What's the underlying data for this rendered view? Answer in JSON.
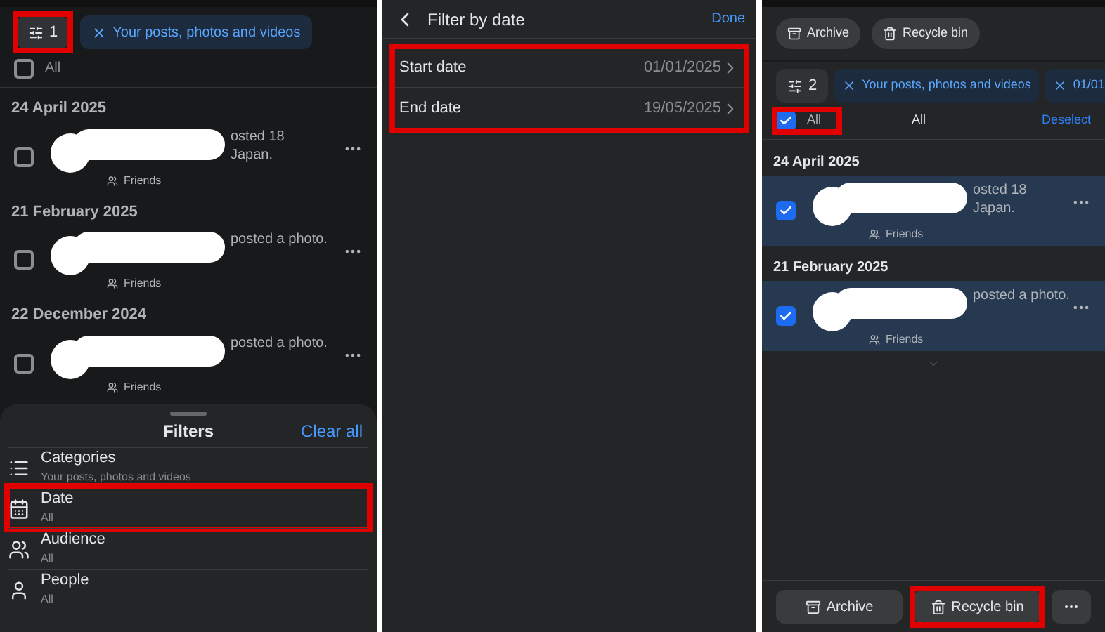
{
  "posts_list": {
    "filter_button": {
      "count": "1",
      "highlighted": true
    },
    "chips": [
      {
        "label": "Your posts, photos and videos"
      }
    ],
    "select_all": {
      "label": "All",
      "checked": false
    },
    "groups": [
      {
        "date": "24 April 2025",
        "posts": [
          {
            "line1": "osted 18",
            "line2": "Japan.",
            "audience": "Friends",
            "checked": false
          }
        ]
      },
      {
        "date": "21 February 2025",
        "posts": [
          {
            "line1": "posted a photo.",
            "audience": "Friends",
            "checked": false
          }
        ]
      },
      {
        "date": "22 December 2024",
        "posts": [
          {
            "line1": "posted a photo.",
            "audience": "Friends",
            "checked": false
          }
        ]
      }
    ],
    "filters_sheet": {
      "title": "Filters",
      "action": "Clear all",
      "items": [
        {
          "kind": "categories",
          "label": "Categories",
          "value": "Your posts, photos and videos",
          "highlighted": false
        },
        {
          "kind": "date",
          "label": "Date",
          "value": "All",
          "highlighted": true
        },
        {
          "kind": "audience",
          "label": "Audience",
          "value": "All",
          "highlighted": false
        },
        {
          "kind": "people",
          "label": "People",
          "value": "All",
          "highlighted": false
        }
      ]
    }
  },
  "date_filter": {
    "title": "Filter by date",
    "action": "Done",
    "highlighted": true,
    "rows": [
      {
        "label": "Start date",
        "value": "01/01/2025"
      },
      {
        "label": "End date",
        "value": "19/05/2025"
      }
    ]
  },
  "selection_view": {
    "top_buttons": [
      {
        "kind": "archive",
        "label": "Archive"
      },
      {
        "kind": "recycle",
        "label": "Recycle bin"
      }
    ],
    "filter_button": {
      "count": "2",
      "highlighted": false
    },
    "chips": [
      {
        "label": "Your posts, photos and videos"
      },
      {
        "label": "01/01"
      }
    ],
    "select_all": {
      "label": "All",
      "checked": true,
      "highlighted": true
    },
    "selection_label": "All",
    "deselect": "Deselect",
    "groups": [
      {
        "date": "24 April 2025",
        "posts": [
          {
            "line1": "osted 18",
            "line2": "Japan.",
            "audience": "Friends",
            "checked": true
          }
        ]
      },
      {
        "date": "21 February 2025",
        "posts": [
          {
            "line1": "posted a photo.",
            "audience": "Friends",
            "checked": true
          }
        ]
      }
    ],
    "bottom_buttons": [
      {
        "kind": "archive",
        "label": "Archive",
        "highlighted": false
      },
      {
        "kind": "recycle",
        "label": "Recycle bin",
        "highlighted": true
      },
      {
        "kind": "more",
        "highlighted": false
      }
    ]
  }
}
